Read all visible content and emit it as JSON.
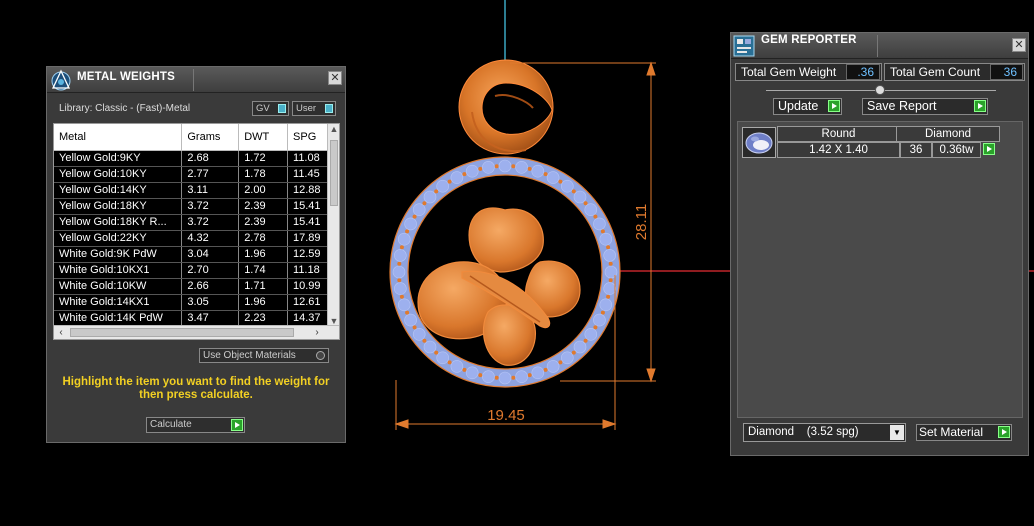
{
  "viewport": {
    "dimension_width": "19.45",
    "dimension_height": "28.11"
  },
  "metal_weights": {
    "title": "METAL WEIGHTS",
    "library": "Library: Classic - (Fast)-Metal",
    "toggle_gv": "GV",
    "toggle_user": "User",
    "columns": [
      "Metal",
      "Grams",
      "DWT",
      "SPG"
    ],
    "rows": [
      [
        "Yellow Gold:9KY",
        "2.68",
        "1.72",
        "11.08"
      ],
      [
        "Yellow Gold:10KY",
        "2.77",
        "1.78",
        "11.45"
      ],
      [
        "Yellow Gold:14KY",
        "3.11",
        "2.00",
        "12.88"
      ],
      [
        "Yellow Gold:18KY",
        "3.72",
        "2.39",
        "15.41"
      ],
      [
        "Yellow Gold:18KY R...",
        "3.72",
        "2.39",
        "15.41"
      ],
      [
        "Yellow Gold:22KY",
        "4.32",
        "2.78",
        "17.89"
      ],
      [
        "White Gold:9K PdW",
        "3.04",
        "1.96",
        "12.59"
      ],
      [
        "White Gold:10KX1",
        "2.70",
        "1.74",
        "11.18"
      ],
      [
        "White Gold:10KW",
        "2.66",
        "1.71",
        "10.99"
      ],
      [
        "White Gold:14KX1",
        "3.05",
        "1.96",
        "12.61"
      ],
      [
        "White Gold:14K PdW",
        "3.47",
        "2.23",
        "14.37"
      ]
    ],
    "use_object_materials": "Use Object Materials",
    "hint": "Highlight the item you want to find the weight for then press calculate.",
    "calculate_label": "Calculate"
  },
  "gem_reporter": {
    "title": "GEM REPORTER",
    "total_weight_label": "Total Gem Weight",
    "total_weight_value": ".36",
    "total_count_label": "Total Gem Count",
    "total_count_value": "36",
    "update_label": "Update",
    "save_report_label": "Save Report",
    "gem_row": {
      "shape": "Round",
      "material": "Diamond",
      "size": "1.42 X 1.40",
      "count": "36",
      "weight": "0.36tw"
    },
    "material_select": "Diamond    (3.52 spg)",
    "set_material_label": "Set Material"
  },
  "colors": {
    "metal": "#e07a2e",
    "gem_blue": "#8fa8e8",
    "accent_cyan": "#4ab0c8",
    "hint_yellow": "#f2d023"
  }
}
